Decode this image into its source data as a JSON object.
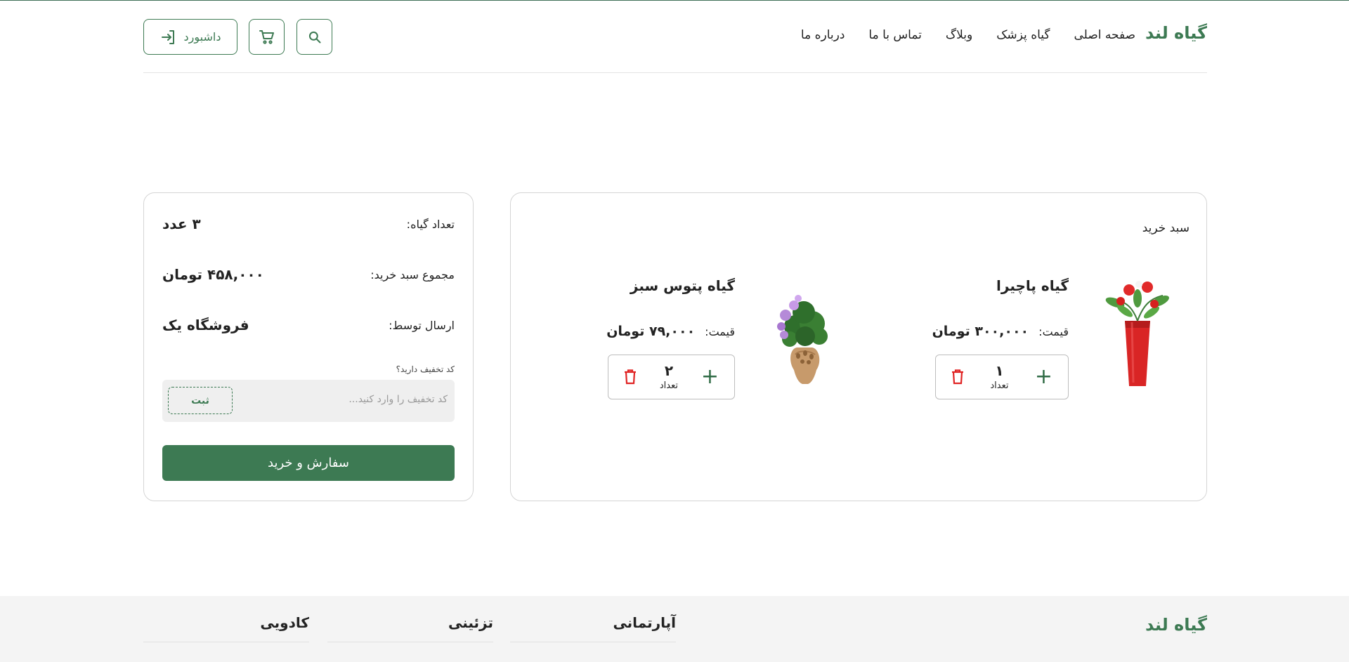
{
  "header": {
    "brand": "گیاه لند",
    "nav": [
      "صفحه اصلی",
      "گیاه پزشک",
      "وبلاگ",
      "تماس با ما",
      "درباره ما"
    ],
    "dashboard_label": "داشبورد",
    "icons": {
      "search": "search-icon",
      "cart": "cart-icon",
      "login": "login-icon"
    }
  },
  "cart": {
    "title": "سبد خرید",
    "items": [
      {
        "name": "گیاه پاچیرا",
        "price_label": "قیمت:",
        "price": "۳۰۰,۰۰۰ تومان",
        "qty": "۱",
        "qty_label": "تعداد"
      },
      {
        "name": "گیاه پتوس سبز",
        "price_label": "قیمت:",
        "price": "۷۹,۰۰۰ تومان",
        "qty": "۲",
        "qty_label": "تعداد"
      }
    ]
  },
  "summary": {
    "count_label": "تعداد گیاه:",
    "count_value": "۳ عدد",
    "total_label": "مجموع سبد خرید:",
    "total_value": "۴۵۸,۰۰۰ تومان",
    "ship_label": "ارسال توسط:",
    "ship_value": "فروشگاه یک",
    "discount_question": "کد تخفیف دارید؟",
    "discount_placeholder": "کد تخفیف را وارد کنید...",
    "discount_submit": "ثبت",
    "order_button": "سفارش و خرید"
  },
  "footer": {
    "brand": "گیاه لند",
    "columns": [
      "آپارتمانی",
      "تزئینی",
      "کادویی"
    ]
  },
  "colors": {
    "accent": "#3d7a53",
    "danger": "#e02424"
  }
}
